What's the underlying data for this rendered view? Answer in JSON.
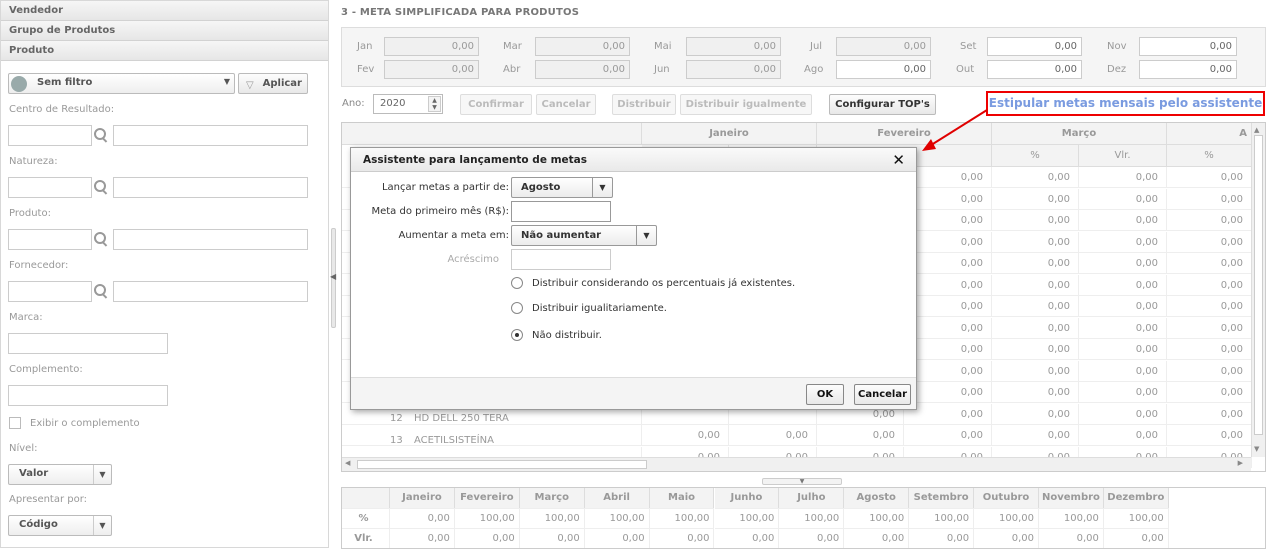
{
  "sidebar": {
    "sections": [
      "Vendedor",
      "Grupo de Produtos",
      "Produto"
    ],
    "filter_value": "Sem filtro",
    "apply_label": "Aplicar",
    "fields": [
      "Centro de Resultado:",
      "Natureza:",
      "Produto:",
      "Fornecedor:",
      "Marca:",
      "Complemento:"
    ],
    "show_complement_label": "Exibir o complemento",
    "level_label": "Nível:",
    "level_value": "Valor",
    "present_by_label": "Apresentar por:",
    "present_by_value": "Código"
  },
  "main": {
    "section_title": "3 - META SIMPLIFICADA PARA PRODUTOS",
    "months_top": [
      {
        "label": "Jan",
        "value": "0,00"
      },
      {
        "label": "Mar",
        "value": "0,00"
      },
      {
        "label": "Mai",
        "value": "0,00"
      },
      {
        "label": "Jul",
        "value": "0,00"
      },
      {
        "label": "Set",
        "value": "0,00"
      },
      {
        "label": "Nov",
        "value": "0,00"
      }
    ],
    "months_bottom": [
      {
        "label": "Fev",
        "value": "0,00"
      },
      {
        "label": "Abr",
        "value": "0,00"
      },
      {
        "label": "Jun",
        "value": "0,00"
      },
      {
        "label": "Ago",
        "value": "0,00"
      },
      {
        "label": "Out",
        "value": "0,00"
      },
      {
        "label": "Dez",
        "value": "0,00"
      }
    ],
    "year_label": "Ano:",
    "year_value": "2020",
    "toolbar": {
      "confirm": "Confirmar",
      "cancel": "Cancelar",
      "distribute": "Distribuir",
      "distribute_equal": "Distribuir igualmente",
      "config_tops": "Configurar TOP's"
    },
    "callout": "Estipular metas mensais pelo assistente",
    "grid": {
      "month_headers": [
        "Janeiro",
        "Fevereiro",
        "Março",
        "A"
      ],
      "sub_headers": [
        "Vlr.",
        "%",
        "Vlr.",
        "%"
      ],
      "cell_value": "0,00",
      "products": [
        {
          "num": "12",
          "name": "HD DELL 250 TERA"
        },
        {
          "num": "13",
          "name": "ACETILSISTEÍNA"
        }
      ]
    },
    "summary": {
      "months": [
        "Janeiro",
        "Fevereiro",
        "Março",
        "Abril",
        "Maio",
        "Junho",
        "Julho",
        "Agosto",
        "Setembro",
        "Outubro",
        "Novembro",
        "Dezembro"
      ],
      "row_labels": [
        "%",
        "Vlr."
      ],
      "pct": [
        "0,00",
        "100,00",
        "100,00",
        "100,00",
        "100,00",
        "100,00",
        "100,00",
        "100,00",
        "100,00",
        "100,00",
        "100,00",
        "100,00"
      ],
      "vlr": [
        "0,00",
        "0,00",
        "0,00",
        "0,00",
        "0,00",
        "0,00",
        "0,00",
        "0,00",
        "0,00",
        "0,00",
        "0,00",
        "0,00"
      ]
    }
  },
  "dialog": {
    "title": "Assistente para lançamento de metas",
    "start_label": "Lançar metas a partir de:",
    "start_value": "Agosto",
    "first_month_label": "Meta do primeiro mês (R$):",
    "increase_label": "Aumentar a meta em:",
    "increase_value": "Não aumentar",
    "increment_label": "Acréscimo",
    "options": [
      "Distribuir considerando os percentuais já existentes.",
      "Distribuir igualitariamente.",
      "Não distribuir."
    ],
    "selected_option": 2,
    "ok": "OK",
    "cancel": "Cancelar"
  },
  "colors": {
    "callout_border": "#e00000",
    "callout_text": "#7a9be0",
    "arrow": "#e00000"
  }
}
